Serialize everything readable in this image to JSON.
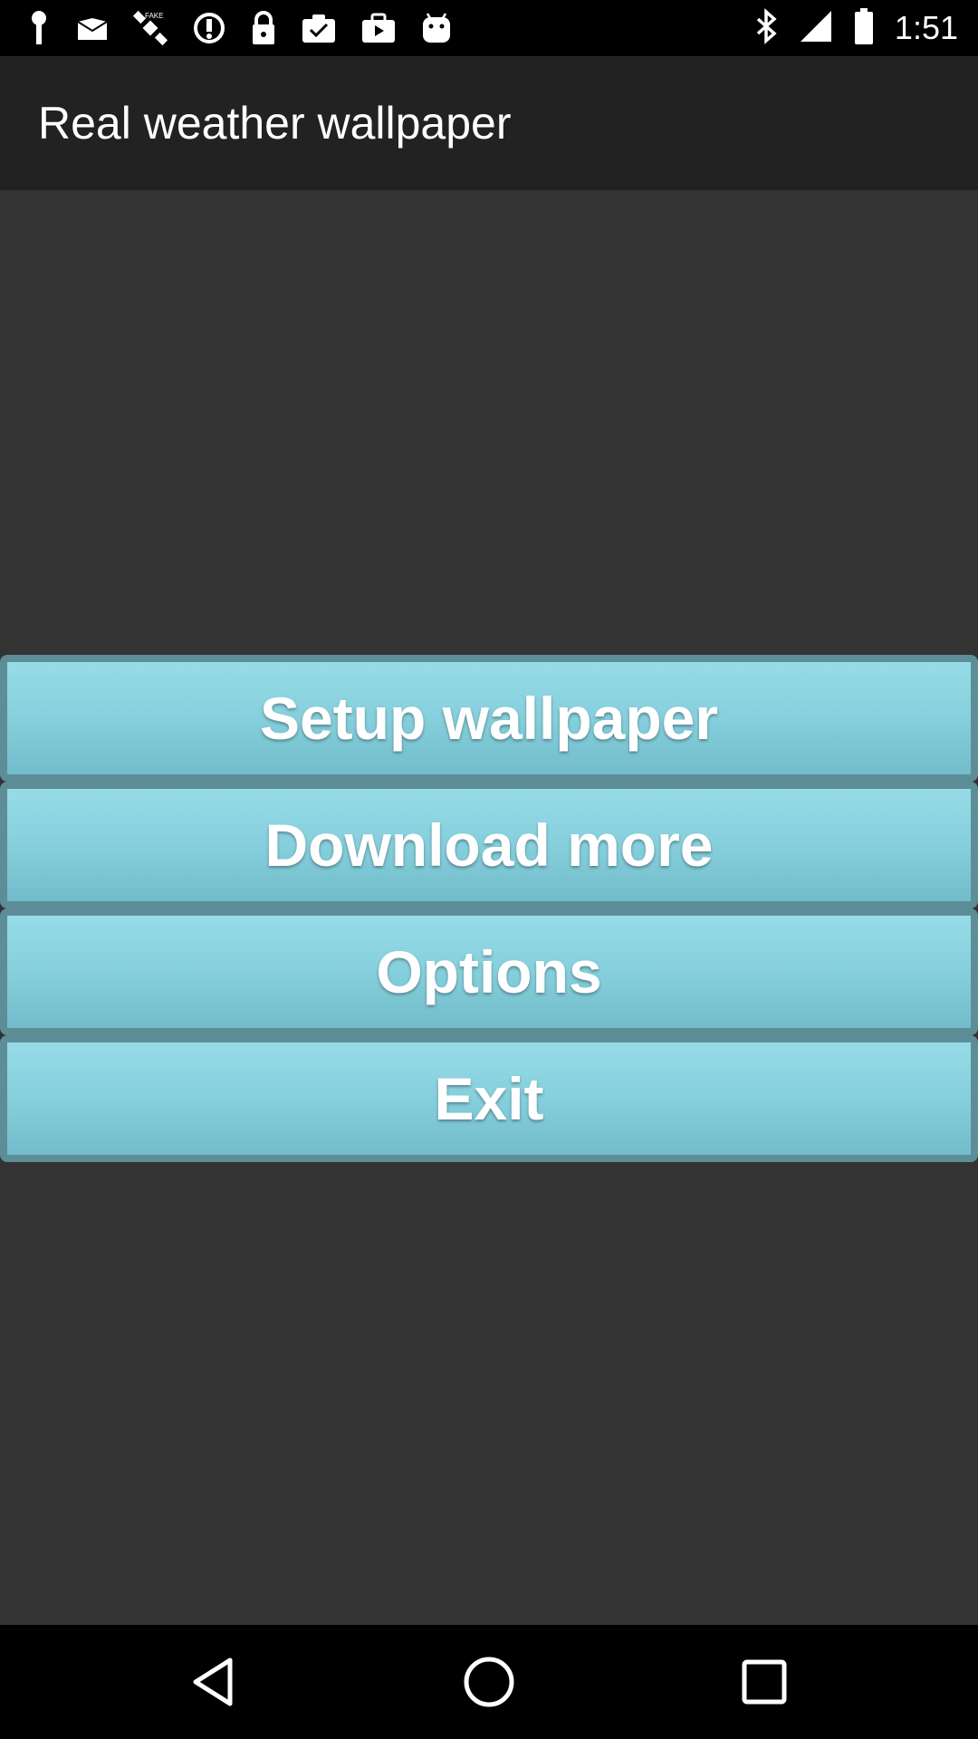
{
  "status_bar": {
    "time": "1:51",
    "left_icons": [
      "fake-gps-icon",
      "mail-icon",
      "satellite-icon",
      "data-saver-icon",
      "lock-icon",
      "clipboard-check-icon",
      "briefcase-play-icon",
      "android-icon"
    ],
    "right_icons": [
      "bluetooth-icon",
      "signal-icon",
      "battery-icon"
    ]
  },
  "app_bar": {
    "title": "Real weather wallpaper"
  },
  "menu": {
    "buttons": [
      {
        "label": "Setup wallpaper"
      },
      {
        "label": "Download more"
      },
      {
        "label": "Options"
      },
      {
        "label": "Exit"
      }
    ]
  },
  "nav_bar": {
    "buttons": [
      "back-icon",
      "home-icon",
      "recents-icon"
    ]
  },
  "colors": {
    "background": "#333333",
    "app_bar": "#222222",
    "button_top": "#97dbe8",
    "button_bottom": "#72bccb",
    "button_border": "#5d8e98",
    "text": "#ffffff"
  }
}
